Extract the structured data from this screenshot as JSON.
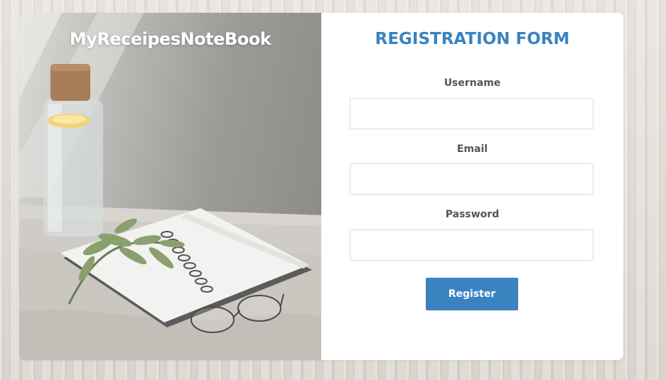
{
  "brand": {
    "title": "MyReceipesNoteBook"
  },
  "form": {
    "title": "REGISTRATION FORM",
    "fields": [
      {
        "label": "Username",
        "value": "",
        "placeholder": ""
      },
      {
        "label": "Email",
        "value": "",
        "placeholder": ""
      },
      {
        "label": "Password",
        "value": "",
        "placeholder": ""
      }
    ],
    "submit_label": "Register"
  },
  "colors": {
    "accent": "#3a83c0",
    "label": "#555555",
    "card_background": "#ffffff",
    "input_border": "#dcdcdc"
  }
}
